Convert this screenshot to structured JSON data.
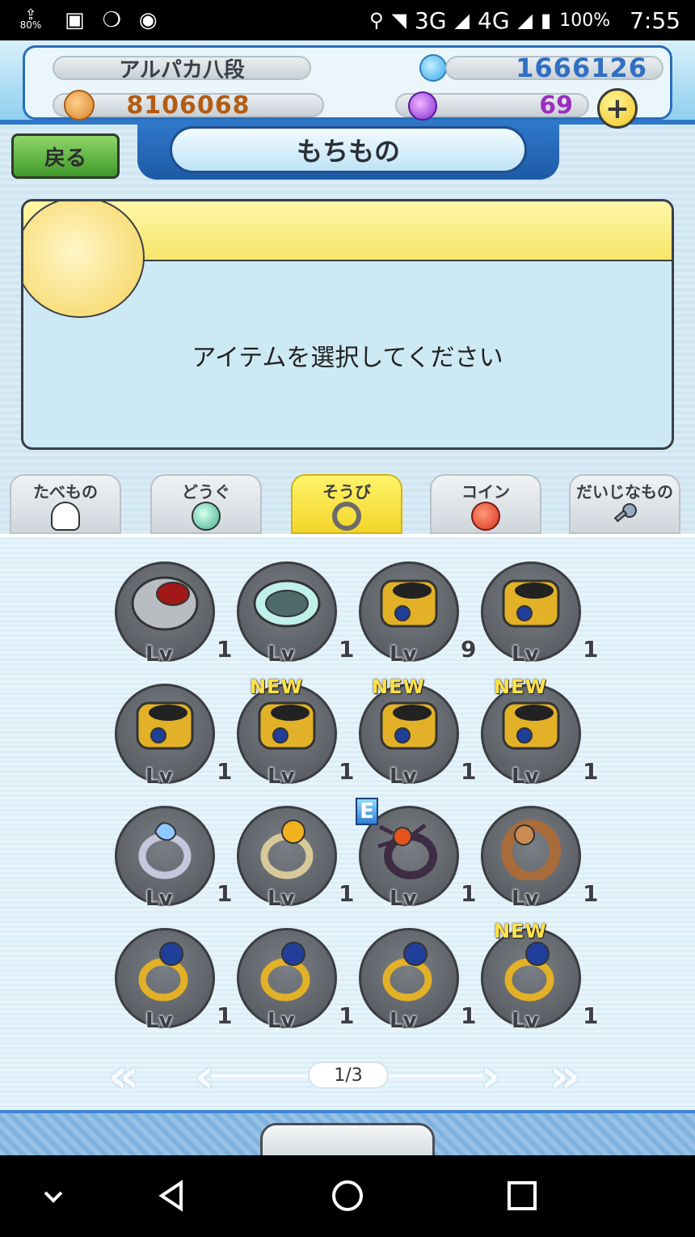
{
  "status_bar": {
    "battery_small": "80%",
    "network_3g": "3G",
    "network_4g": "4G",
    "battery_percent": "100%",
    "time": "7:55"
  },
  "header": {
    "player_name": "アルパカ八段",
    "gems": "1666126",
    "money": "8106068",
    "orbs": "69",
    "plus_label": "+"
  },
  "nav": {
    "back_label": "戻る",
    "screen_title": "もちもの"
  },
  "message": {
    "text": "アイテムを選択してください"
  },
  "tabs": [
    {
      "label": "たべもの",
      "icon": "onigiri-icon",
      "active": false
    },
    {
      "label": "どうぐ",
      "icon": "orb-icon",
      "active": false
    },
    {
      "label": "そうび",
      "icon": "ring-icon",
      "active": true
    },
    {
      "label": "コイン",
      "icon": "coin-icon",
      "active": false
    },
    {
      "label": "だいじなもの",
      "icon": "key-icon",
      "active": false
    }
  ],
  "items": [
    {
      "name": "silver-red-bracelet",
      "lv_label": "Lv",
      "level": "1",
      "new": "",
      "equipped": ""
    },
    {
      "name": "jade-bracelet",
      "lv_label": "Lv",
      "level": "1",
      "new": "",
      "equipped": ""
    },
    {
      "name": "gold-bracer",
      "lv_label": "Lv",
      "level": "9",
      "new": "",
      "equipped": ""
    },
    {
      "name": "gold-bracer",
      "lv_label": "Lv",
      "level": "1",
      "new": "",
      "equipped": ""
    },
    {
      "name": "gold-bracer",
      "lv_label": "Lv",
      "level": "1",
      "new": "",
      "equipped": ""
    },
    {
      "name": "gold-bracer",
      "lv_label": "Lv",
      "level": "1",
      "new": "NEW",
      "equipped": ""
    },
    {
      "name": "gold-bracer",
      "lv_label": "Lv",
      "level": "1",
      "new": "NEW",
      "equipped": ""
    },
    {
      "name": "gold-bracer",
      "lv_label": "Lv",
      "level": "1",
      "new": "NEW",
      "equipped": ""
    },
    {
      "name": "blue-flame-ring",
      "lv_label": "Lv",
      "level": "1",
      "new": "",
      "equipped": ""
    },
    {
      "name": "gold-gem-ring",
      "lv_label": "Lv",
      "level": "1",
      "new": "",
      "equipped": ""
    },
    {
      "name": "dark-spider-ring",
      "lv_label": "Lv",
      "level": "1",
      "new": "",
      "equipped": "E"
    },
    {
      "name": "wooden-ring",
      "lv_label": "Lv",
      "level": "1",
      "new": "",
      "equipped": ""
    },
    {
      "name": "gold-sapphire-ring",
      "lv_label": "Lv",
      "level": "1",
      "new": "",
      "equipped": ""
    },
    {
      "name": "gold-sapphire-ring",
      "lv_label": "Lv",
      "level": "1",
      "new": "",
      "equipped": ""
    },
    {
      "name": "gold-sapphire-ring",
      "lv_label": "Lv",
      "level": "1",
      "new": "",
      "equipped": ""
    },
    {
      "name": "gold-sapphire-ring",
      "lv_label": "Lv",
      "level": "1",
      "new": "NEW",
      "equipped": ""
    }
  ],
  "pager": {
    "first": "«",
    "prev": "‹",
    "next": "›",
    "last": "»",
    "page": "1/3"
  },
  "colors": {
    "accent_blue": "#2f78c9",
    "tab_active": "#f3d529",
    "gold": "#e2b127",
    "sapphire": "#1f3f9a"
  }
}
